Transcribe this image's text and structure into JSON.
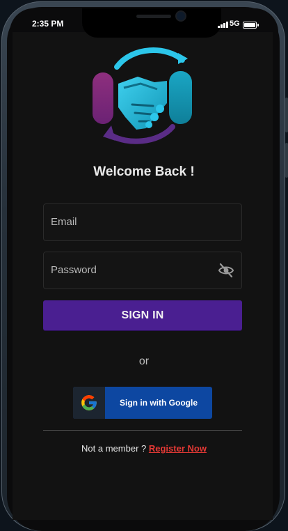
{
  "status_bar": {
    "time": "2:35 PM",
    "network": "5G"
  },
  "welcome": {
    "title": "Welcome Back !"
  },
  "form": {
    "email_placeholder": "Email",
    "password_placeholder": "Password",
    "sign_in_label": "SIGN IN"
  },
  "separator": {
    "text": "or"
  },
  "google": {
    "label": "Sign in with Google"
  },
  "register": {
    "prompt": "Not a member ? ",
    "link_label": "Register Now"
  },
  "colors": {
    "background": "#121212",
    "primary": "#4a1f91",
    "google_blue": "#0d47a1",
    "link": "#e53935"
  }
}
